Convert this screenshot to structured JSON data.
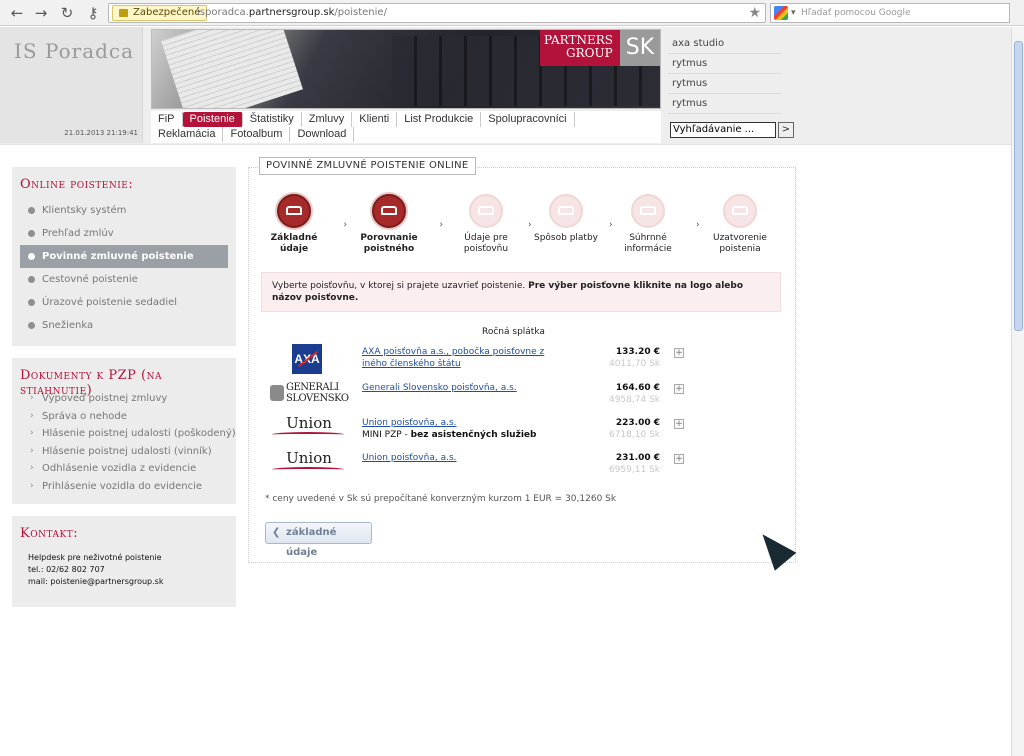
{
  "browser": {
    "secure_label": "Zabezpečené",
    "url_host": "isporadca.",
    "url_domain": "partnersgroup.sk",
    "url_path": "/poistenie/",
    "search_placeholder": "Hľadať pomocou Google"
  },
  "header": {
    "logo": "IS Poradca",
    "datetime": "21.01.2013 21:19:41",
    "brand_line1": "PARTNERS",
    "brand_line2": "GROUP",
    "brand_sk": "SK",
    "menu_row1": [
      "FiP",
      "Poistenie",
      "Štatistiky",
      "Zmluvy",
      "Klienti",
      "List Produkcie",
      "Spolupracovníci"
    ],
    "menu_row2": [
      "Reklamácia",
      "Fotoalbum",
      "Download"
    ],
    "active_menu": "Poistenie",
    "news": [
      "axa studio",
      "rytmus",
      "rytmus",
      "rytmus"
    ],
    "search_value": "Vyhľadávanie ...",
    "search_go": ">"
  },
  "sidebar": {
    "online_title": "Online poistenie:",
    "online_items": [
      {
        "label": "Klientsky systém",
        "active": false
      },
      {
        "label": "Prehľad zmlúv",
        "active": false
      },
      {
        "label": "Povinné zmluvné poistenie",
        "active": true
      },
      {
        "label": "Cestovné poistenie",
        "active": false
      },
      {
        "label": "Úrazové poistenie sedadiel",
        "active": false
      },
      {
        "label": "Snežienka",
        "active": false
      }
    ],
    "docs_title": "Dokumenty k PZP (na stiahnutie)",
    "doc_items": [
      "Výpoveď poistnej zmluvy",
      "Správa o nehode",
      "Hlásenie poistnej udalosti (poškodený)",
      "Hlásenie poistnej udalosti (vinník)",
      "Odhlásenie vozidla z evidencie",
      "Prihlásenie vozidla do evidencie"
    ],
    "contact_title": "Kontakt:",
    "contact_lines": [
      "Helpdesk pre neživotné poistenie",
      "tel.: 02/62 802 707",
      "mail: poistenie@partnersgroup.sk"
    ]
  },
  "main": {
    "title": "Povinné zmluvné poistenie online",
    "steps": [
      {
        "label": "Základné údaje",
        "active": true
      },
      {
        "label": "Porovnanie poistného",
        "active": true
      },
      {
        "label": "Údaje pre poisťovňu",
        "active": false
      },
      {
        "label": "Spôsob platby",
        "active": false
      },
      {
        "label": "Súhrnné informácie",
        "active": false
      },
      {
        "label": "Uzatvorenie poistenia",
        "active": false
      }
    ],
    "info_text": "Vyberte poisťovňu, v ktorej si prajete uzavrieť poistenie. ",
    "info_bold": "Pre výber poisťovne kliknite na logo alebo názov poisťovne.",
    "annual_label": "Ročná splátka",
    "offers": [
      {
        "logo": "axa",
        "logo_text": "AXA",
        "name": "AXA poisťovňa a.s., pobočka poisťovne z iného členského štátu",
        "note": "",
        "eur": "133.20 €",
        "sk": "4011,70 Sk"
      },
      {
        "logo": "generali",
        "logo_text": "GENERALI SLOVENSKO",
        "name": "Generali Slovensko poisťovňa, a.s.",
        "note": "",
        "eur": "164.60 €",
        "sk": "4958,74 Sk"
      },
      {
        "logo": "union",
        "logo_text": "Union",
        "name": "Union poisťovňa, a.s.",
        "note": "MINI PZP - ",
        "note_bold": "bez asistenčných služieb",
        "eur": "223.00 €",
        "sk": "6718,10 Sk"
      },
      {
        "logo": "union",
        "logo_text": "Union",
        "name": "Union poisťovňa, a.s.",
        "note": "",
        "eur": "231.00 €",
        "sk": "6959,11 Sk"
      }
    ],
    "footnote": "* ceny uvedené v Sk sú prepočítané konverzným kurzom 1 EUR = 30,1260 Sk",
    "back_label": "základné údaje"
  }
}
